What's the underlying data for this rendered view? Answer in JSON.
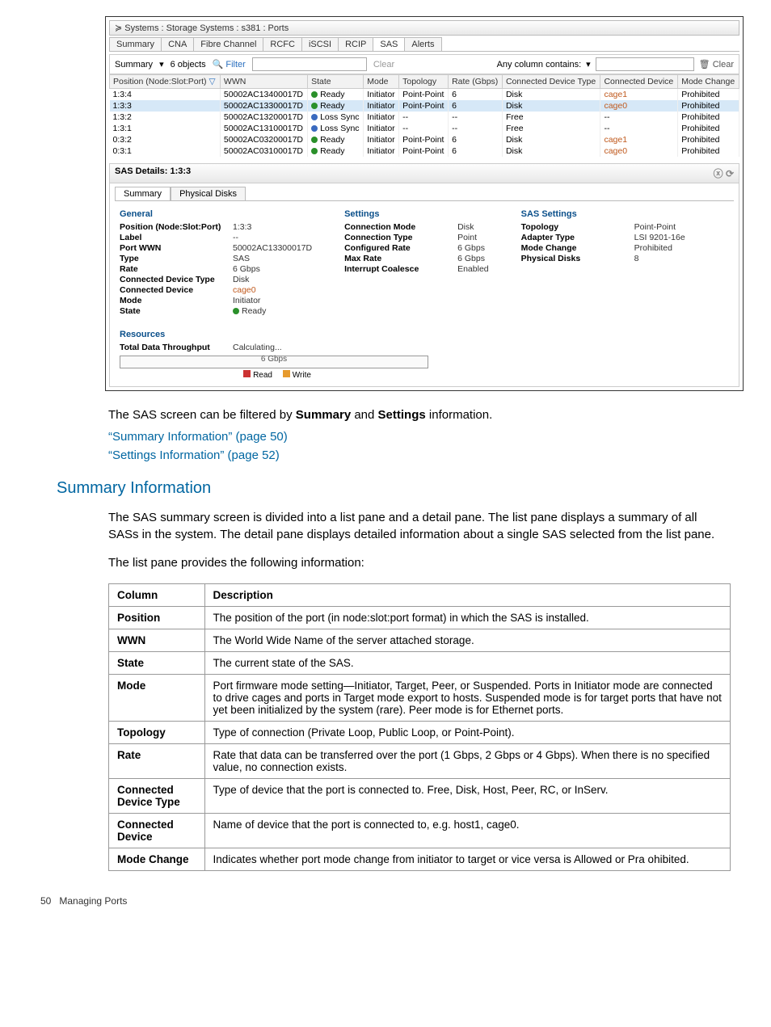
{
  "breadcrumb": "≽ Systems : Storage Systems : s381 : Ports",
  "topTabs": [
    "Summary",
    "CNA",
    "Fibre Channel",
    "RCFC",
    "iSCSI",
    "RCIP",
    "SAS",
    "Alerts"
  ],
  "topTabActive": "SAS",
  "toolbar": {
    "left_label": "Summary",
    "objects": "6 objects",
    "filter": "Filter",
    "clear": "Clear",
    "anycol": "Any column contains:",
    "clear_right": "Clear"
  },
  "listHeaders": [
    "Position (Node:Slot:Port)",
    "WWN",
    "State",
    "Mode",
    "Topology",
    "Rate (Gbps)",
    "Connected Device Type",
    "Connected Device",
    "Mode Change"
  ],
  "rows": [
    {
      "pos": "1:3:4",
      "wwn": "50002AC13400017D",
      "state": "Ready",
      "dot": "green",
      "mode": "Initiator",
      "topo": "Point-Point",
      "rate": "6",
      "cdt": "Disk",
      "cdev": "cage1",
      "mc": "Prohibited",
      "sel": false
    },
    {
      "pos": "1:3:3",
      "wwn": "50002AC13300017D",
      "state": "Ready",
      "dot": "green",
      "mode": "Initiator",
      "topo": "Point-Point",
      "rate": "6",
      "cdt": "Disk",
      "cdev": "cage0",
      "mc": "Prohibited",
      "sel": true
    },
    {
      "pos": "1:3:2",
      "wwn": "50002AC13200017D",
      "state": "Loss Sync",
      "dot": "blue",
      "mode": "Initiator",
      "topo": "--",
      "rate": "--",
      "cdt": "Free",
      "cdev": "--",
      "mc": "Prohibited",
      "sel": false
    },
    {
      "pos": "1:3:1",
      "wwn": "50002AC13100017D",
      "state": "Loss Sync",
      "dot": "blue",
      "mode": "Initiator",
      "topo": "--",
      "rate": "--",
      "cdt": "Free",
      "cdev": "--",
      "mc": "Prohibited",
      "sel": false
    },
    {
      "pos": "0:3:2",
      "wwn": "50002AC03200017D",
      "state": "Ready",
      "dot": "green",
      "mode": "Initiator",
      "topo": "Point-Point",
      "rate": "6",
      "cdt": "Disk",
      "cdev": "cage1",
      "mc": "Prohibited",
      "sel": false
    },
    {
      "pos": "0:3:1",
      "wwn": "50002AC03100017D",
      "state": "Ready",
      "dot": "green",
      "mode": "Initiator",
      "topo": "Point-Point",
      "rate": "6",
      "cdt": "Disk",
      "cdev": "cage0",
      "mc": "Prohibited",
      "sel": false
    }
  ],
  "details": {
    "title": "SAS Details: 1:3:3",
    "subtabs": [
      "Summary",
      "Physical Disks"
    ],
    "subtabActive": "Summary",
    "general_label": "General",
    "settings_label": "Settings",
    "sas_settings_label": "SAS Settings",
    "general": {
      "Position (Node:Slot:Port)": "1:3:3",
      "Label": "--",
      "Port WWN": "50002AC13300017D",
      "Type": "SAS",
      "Rate": "6 Gbps",
      "Connected Device Type": "Disk",
      "Connected Device": "cage0",
      "Mode": "Initiator",
      "State": "Ready"
    },
    "settings": {
      "Connection Mode": "Disk",
      "Connection Type": "Point",
      "Configured Rate": "6 Gbps",
      "Max Rate": "6 Gbps",
      "Interrupt Coalesce": "Enabled"
    },
    "sasSettings": {
      "Topology": "Point-Point",
      "Adapter Type": "LSI 9201-16e",
      "Mode Change": "Prohibited",
      "Physical Disks": "8"
    },
    "resources_label": "Resources",
    "throughput_label": "Total Data Throughput",
    "throughput_value": "Calculating...",
    "bar_mid": "6 Gbps",
    "legend_read": "Read",
    "legend_write": "Write"
  },
  "introText": "The SAS screen can be filtered by Summary and Settings information.",
  "link1": "“Summary Information” (page 50)",
  "link2": "“Settings Information” (page 52)",
  "sectionHeading": "Summary Information",
  "para1": "The SAS summary screen is divided into a list pane and a detail pane. The list pane displays a summary of all SASs in the system. The detail pane displays detailed information about a single SAS selected from the list pane.",
  "para2": "The list pane provides the following information:",
  "descTable": {
    "headers": [
      "Column",
      "Description"
    ],
    "rows": [
      [
        "Position",
        "The position of the port (in node:slot:port format) in which the SAS is installed."
      ],
      [
        "WWN",
        "The World Wide Name of the server attached storage."
      ],
      [
        "State",
        "The current state of the SAS."
      ],
      [
        "Mode",
        "Port firmware mode setting—Initiator, Target, Peer, or Suspended. Ports in Initiator mode are connected to drive cages and ports in Target mode export to hosts. Suspended mode is for target ports that have not yet been initialized by the system (rare). Peer mode is for Ethernet ports."
      ],
      [
        "Topology",
        "Type of connection (Private Loop, Public Loop, or Point-Point)."
      ],
      [
        "Rate",
        "Rate that data can be transferred over the port (1 Gbps, 2 Gbps or 4 Gbps). When there is no specified value, no connection exists."
      ],
      [
        "Connected Device Type",
        "Type of device that the port is connected to. Free, Disk, Host, Peer, RC, or InServ."
      ],
      [
        "Connected Device",
        "Name of device that the port is connected to, e.g. host1, cage0."
      ],
      [
        "Mode Change",
        "Indicates whether port mode change from initiator to target or vice versa is Allowed or Pra ohibited."
      ]
    ]
  },
  "footer_page": "50",
  "footer_text": "Managing Ports"
}
